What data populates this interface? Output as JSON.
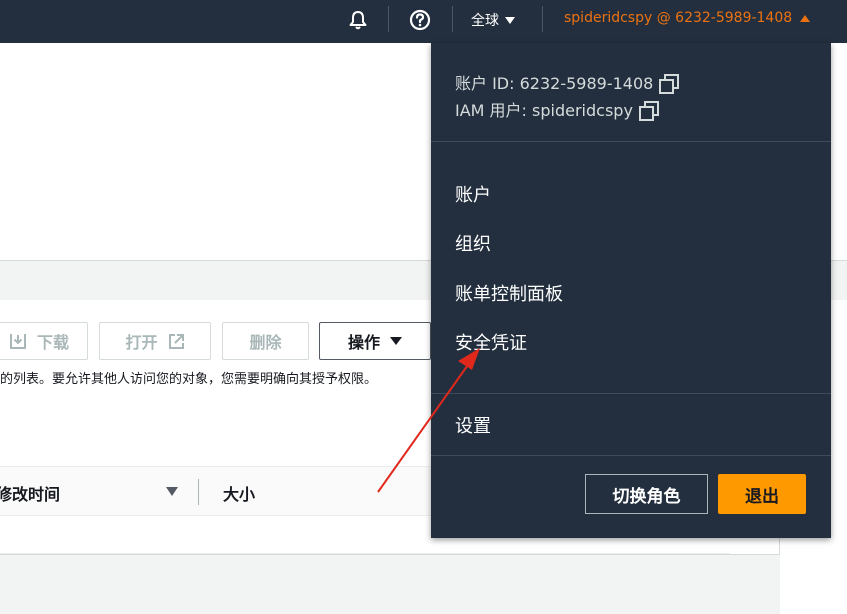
{
  "topbar": {
    "notifications_icon": "bell-icon",
    "help_icon": "question-circle-icon",
    "region_label": "全球",
    "account_label": "spideridcspy @ 6232-5989-1408"
  },
  "toolbar": {
    "download_label": "下载",
    "open_label": "打开",
    "delete_label": "删除",
    "actions_label": "操作"
  },
  "page": {
    "permission_text": "的列表。要允许其他人访问您的对象，您需要明确向其授予权限。"
  },
  "table": {
    "columns": [
      "修改时间",
      "大小"
    ]
  },
  "menu": {
    "account_id": "账户 ID: 6232-5989-1408",
    "iam_user": "IAM 用户: spideridcspy",
    "items": [
      "账户",
      "组织",
      "账单控制面板",
      "安全凭证"
    ],
    "settings_label": "设置",
    "switch_role_label": "切换角色",
    "logout_label": "退出"
  },
  "colors": {
    "nav_bg": "#232f3e",
    "account_accent": "#ec7211",
    "logout_button": "#ff9900",
    "annotation_arrow": "#e0281c"
  }
}
